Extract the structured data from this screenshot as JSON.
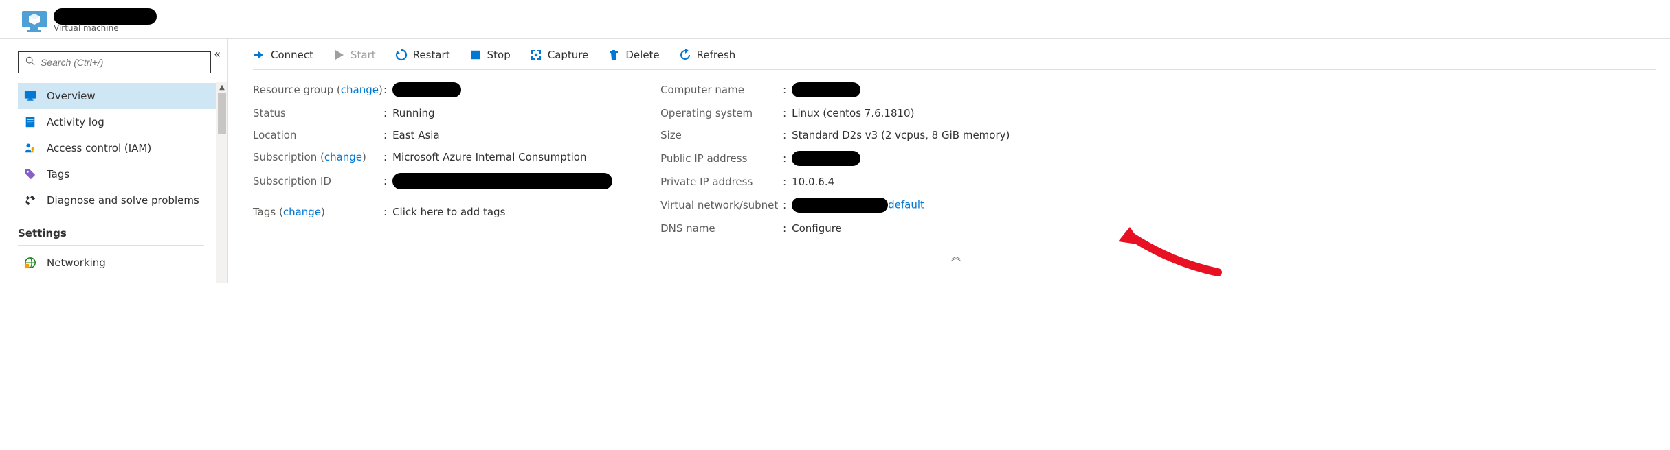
{
  "header": {
    "resource_type": "Virtual machine"
  },
  "sidebar": {
    "search_placeholder": "Search (Ctrl+/)",
    "items": [
      {
        "id": "overview",
        "label": "Overview",
        "icon": "monitor"
      },
      {
        "id": "activity",
        "label": "Activity log",
        "icon": "log"
      },
      {
        "id": "iam",
        "label": "Access control (IAM)",
        "icon": "user-key"
      },
      {
        "id": "tags",
        "label": "Tags",
        "icon": "tag"
      },
      {
        "id": "diagnose",
        "label": "Diagnose and solve problems",
        "icon": "wrench"
      }
    ],
    "settings_header": "Settings",
    "settings_items": [
      {
        "id": "networking",
        "label": "Networking",
        "icon": "globe"
      }
    ]
  },
  "toolbar": {
    "connect": "Connect",
    "start": "Start",
    "restart": "Restart",
    "stop": "Stop",
    "capture": "Capture",
    "delete": "Delete",
    "refresh": "Refresh"
  },
  "properties": {
    "left": {
      "resource_group_label": "Resource group",
      "change_label": "change",
      "status_label": "Status",
      "status_value": "Running",
      "location_label": "Location",
      "location_value": "East Asia",
      "subscription_label": "Subscription",
      "subscription_value": "Microsoft Azure Internal Consumption",
      "subscription_id_label": "Subscription ID"
    },
    "right": {
      "computer_name_label": "Computer name",
      "os_label": "Operating system",
      "os_value": "Linux (centos 7.6.1810)",
      "size_label": "Size",
      "size_value": "Standard D2s v3 (2 vcpus, 8 GiB memory)",
      "public_ip_label": "Public IP address",
      "private_ip_label": "Private IP address",
      "private_ip_value": "10.0.6.4",
      "vnet_label": "Virtual network/subnet",
      "vnet_suffix": "default",
      "dns_label": "DNS name",
      "dns_value": "Configure"
    },
    "tags_label": "Tags",
    "tags_action": "Click here to add tags"
  }
}
